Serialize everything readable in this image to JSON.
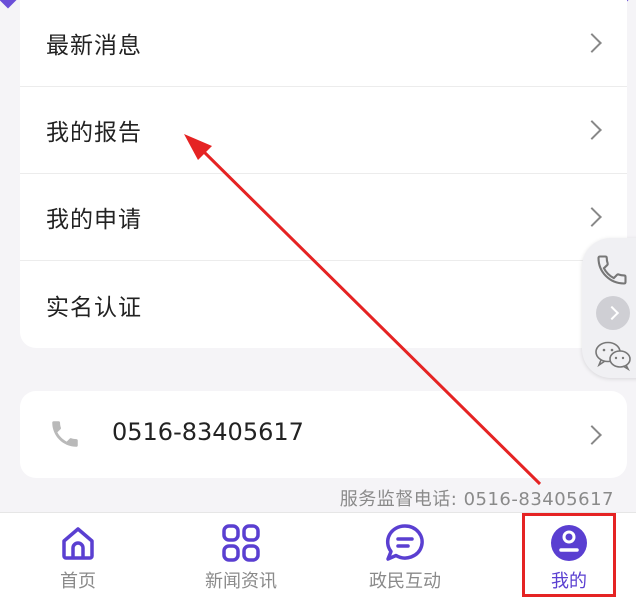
{
  "menu": {
    "items": [
      {
        "label": "最新消息"
      },
      {
        "label": "我的报告"
      },
      {
        "label": "我的申请"
      },
      {
        "label": "实名认证"
      }
    ]
  },
  "contact": {
    "phone_number": "0516-83405617",
    "service_tel": "服务监督电话: 0516-83405617"
  },
  "tabbar": {
    "tabs": [
      {
        "label": "首页",
        "icon": "home-icon",
        "active": false
      },
      {
        "label": "新闻资讯",
        "icon": "grid-icon",
        "active": false
      },
      {
        "label": "政民互动",
        "icon": "chat-bubble-icon",
        "active": false
      },
      {
        "label": "我的",
        "icon": "user-icon",
        "active": true
      }
    ]
  },
  "colors": {
    "accent": "#5a3fd1",
    "annotation": "#e52323"
  }
}
